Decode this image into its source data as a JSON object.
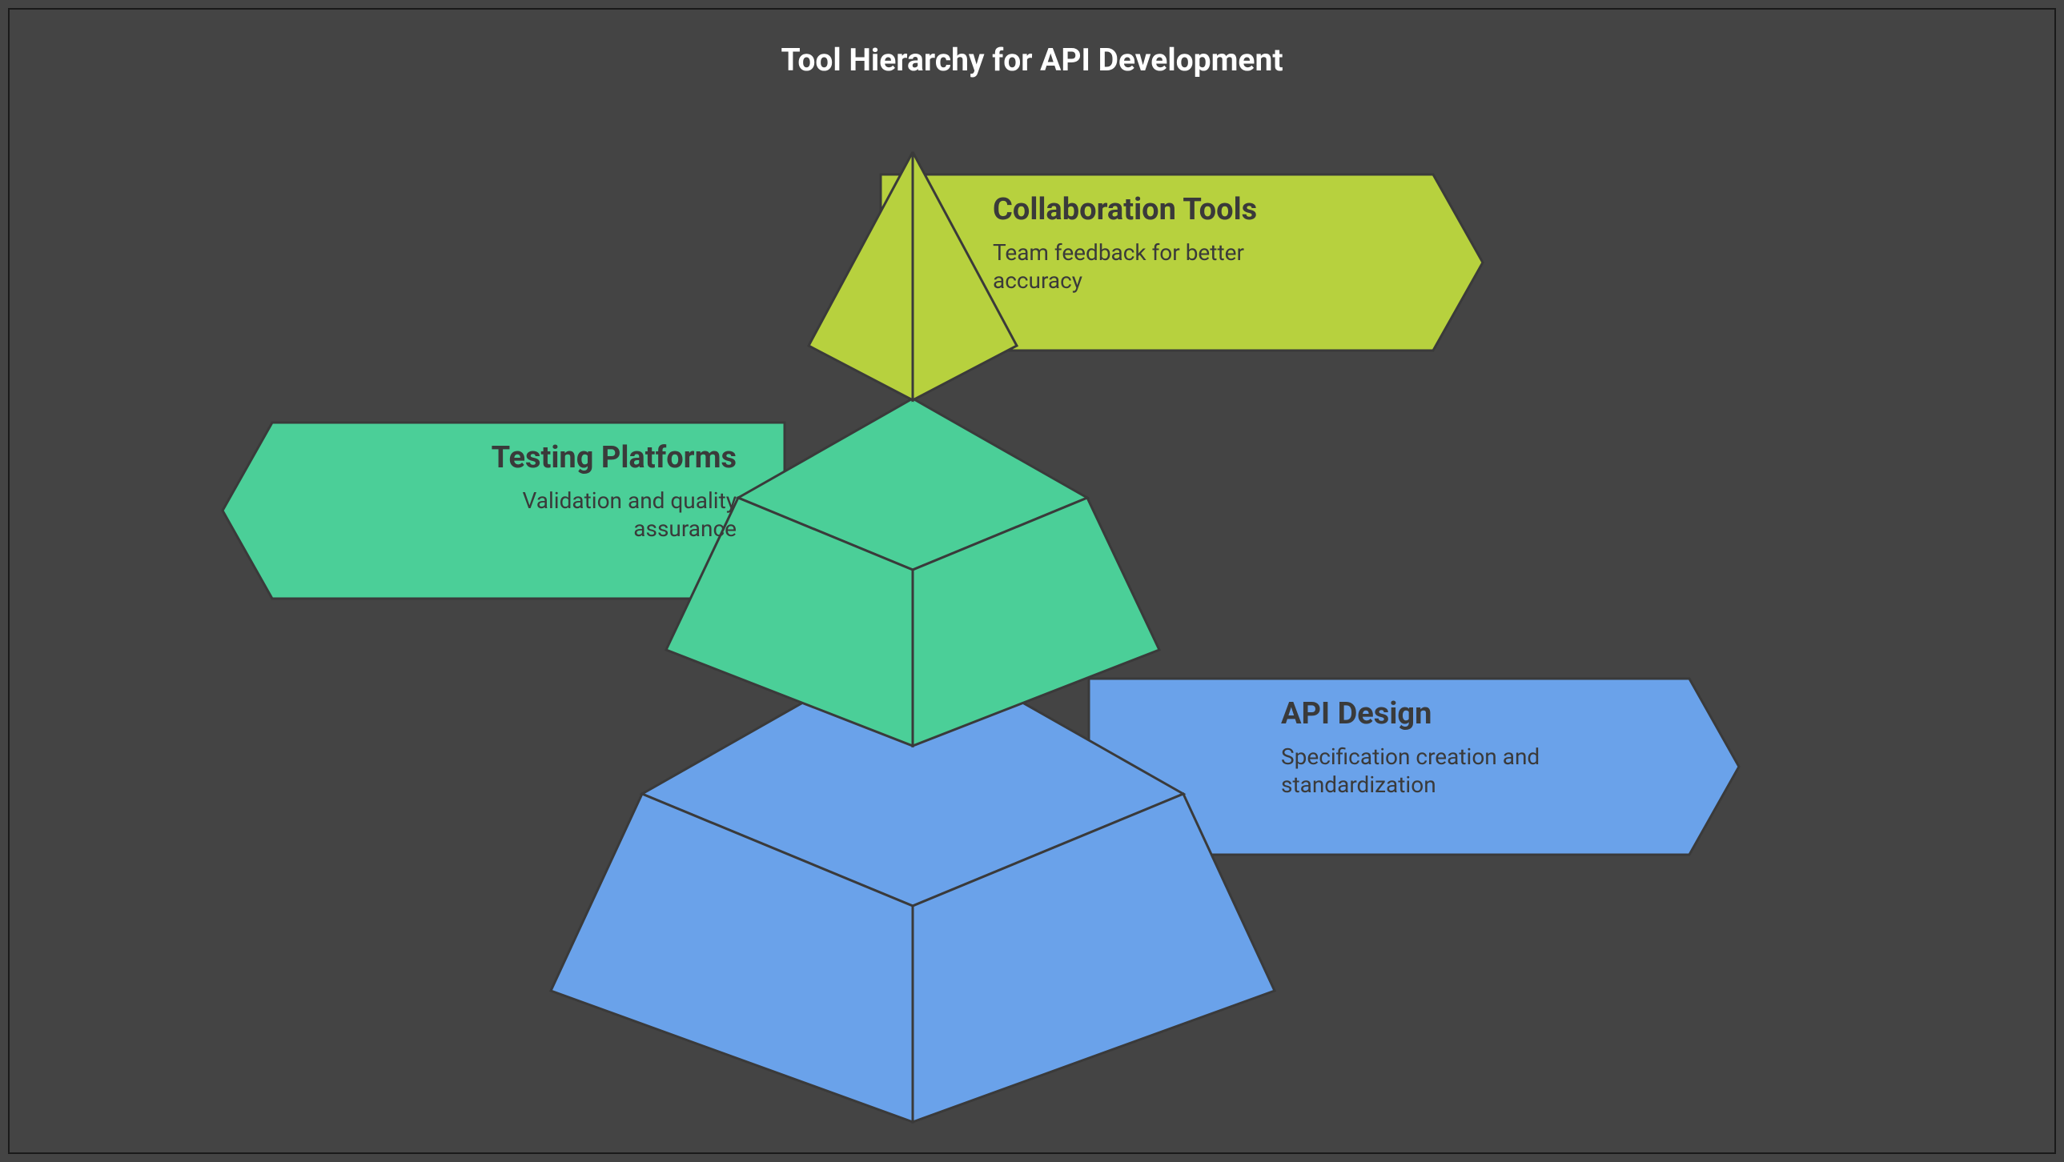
{
  "title": "Tool Hierarchy for API Development",
  "colors": {
    "background": "#444444",
    "stroke": "#3a3a3a",
    "tierTop": "#b7d13e",
    "tierMid": "#4bcf98",
    "tierBot": "#6aa2ea"
  },
  "tiers": [
    {
      "id": "collaboration",
      "heading": "Collaboration Tools",
      "description": "Team feedback for better accuracy",
      "calloutSide": "right",
      "level": "top"
    },
    {
      "id": "testing",
      "heading": "Testing Platforms",
      "description": "Validation and quality assurance",
      "calloutSide": "left",
      "level": "middle"
    },
    {
      "id": "api-design",
      "heading": "API Design",
      "description": "Specification creation and standardization",
      "calloutSide": "right",
      "level": "bottom"
    }
  ]
}
